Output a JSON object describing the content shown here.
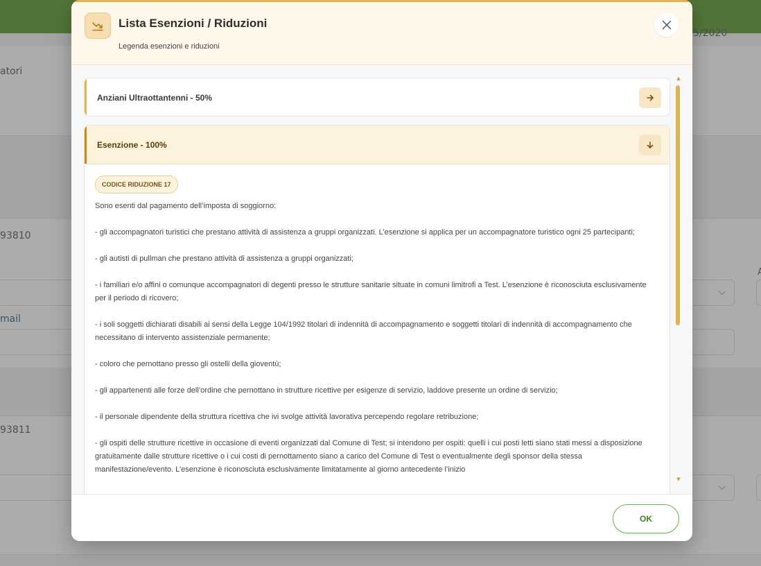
{
  "background": {
    "date_fragment": "5/2020",
    "label_accompagnatori_fragment": "atori",
    "code_1_fragment": "93810",
    "email_fragment": "mail",
    "code_2_fragment": "93811",
    "a_fragment": "A"
  },
  "modal": {
    "title": "Lista Esenzioni / Riduzioni",
    "subtitle": "Legenda esenzioni e riduzioni",
    "header_icon": "trending-down-icon",
    "close_icon": "close-icon",
    "accordion": [
      {
        "title": "Anziani Ultraottantenni - 50%",
        "expanded": false,
        "toggle_icon": "arrow-right-icon"
      },
      {
        "title": "Esenzione - 100%",
        "expanded": true,
        "toggle_icon": "arrow-down-icon",
        "code_badge": "CODICE RIDUZIONE 17",
        "paragraphs": [
          "Sono esenti dal pagamento dell’imposta di soggiorno:",
          "- gli accompagnatori turistici che prestano attività di assistenza a gruppi organizzati. L’esenzione si applica per un accompagnatore turistico ogni 25 partecipanti;",
          "- gli autisti di pullman che prestano attività di assistenza a gruppi organizzati;",
          "- i familiari e/o affini o comunque accompagnatori di degenti presso le strutture sanitarie situate in comuni limitrofi a Test. L’esenzione è riconosciuta esclusivamente per il periodo di ricovero;",
          "- i soli soggetti dichiarati disabili ai sensi della Legge 104/1992 titolari di indennità di accompagnamento e soggetti titolari di indennità di accompagnamento che necessitano di intervento assistenziale permanente;",
          "- coloro che pernottano presso gli ostelli della gioventù;",
          "- gli appartenenti alle forze dell’ordine che pernottano in strutture ricettive per esigenze di servizio, laddove presente un ordine di servizio;",
          "- il personale dipendente della struttura ricettiva che ivi svolge attività lavorativa percependo regolare retribuzione;",
          "- gli ospiti delle strutture ricettive in occasione di eventi organizzati dal Comune di Test; si intendono per ospiti: quelli i cui posti letti siano stati messi a disposizione gratuitamente dalle strutture ricettive o i cui costi di pernottamento siano a carico del Comune di Test o eventualmente degli sponsor della stessa manifestazione/evento. L’esenzione è riconosciuta esclusivamente limitatamente al giorno antecedente l’inizio"
        ]
      }
    ],
    "ok_label": "OK"
  },
  "colors": {
    "accent": "#e3b34f",
    "accent_dark": "#c88a1a",
    "header_bg": "#fdf8ea",
    "brand_green": "#5b9a2e",
    "ok_text": "#3e7f22"
  }
}
